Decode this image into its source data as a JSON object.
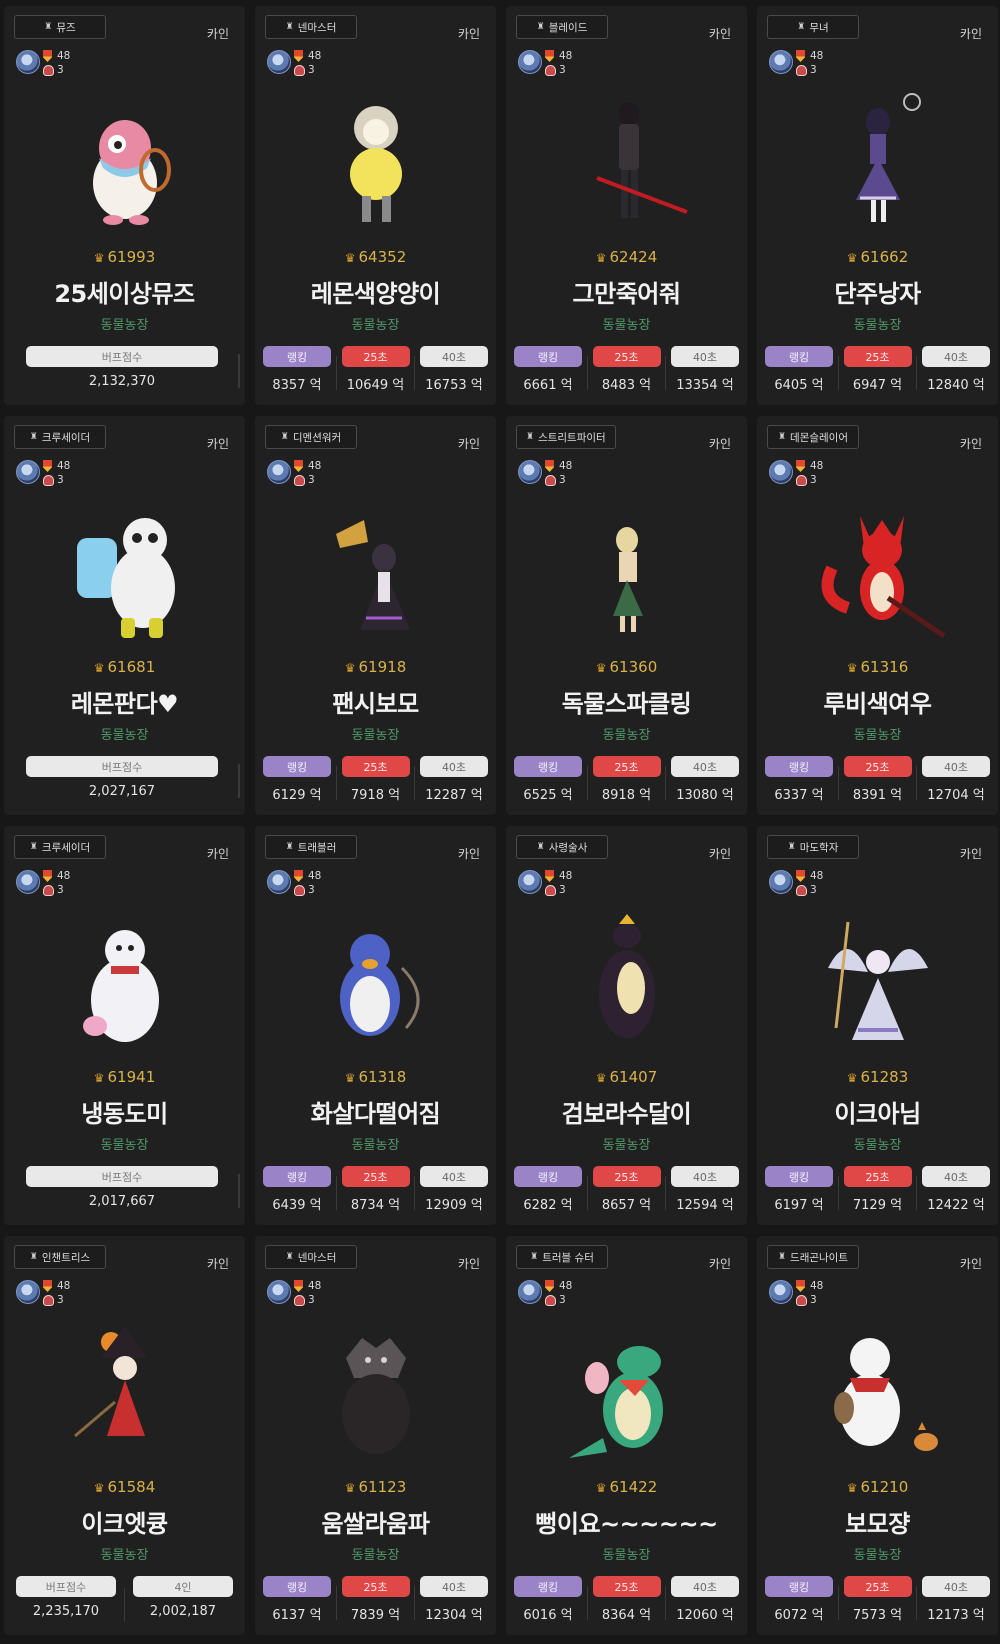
{
  "common": {
    "server": "카인",
    "level_top": "48",
    "level_bottom": "3",
    "unit": "억",
    "label_rank": "랭킹",
    "label_25": "25초",
    "label_40": "40초",
    "label_buff": "버프점수",
    "label_4p": "4인"
  },
  "cards": [
    {
      "job": "뮤즈",
      "fame": "61993",
      "name": "25세이상뮤즈",
      "guild": "동물농장",
      "type": "buff",
      "buff": "2,132,370",
      "sprite": "pink-penguin",
      "colors": [
        "#e88aa4",
        "#f5f0ea",
        "#c06a30"
      ]
    },
    {
      "job": "넨마스터",
      "fame": "64352",
      "name": "레몬색양양이",
      "guild": "동물농장",
      "type": "dps",
      "rank": "8357",
      "t25": "10649",
      "t40": "16753",
      "sprite": "yellow-sheep",
      "colors": [
        "#f2e25c",
        "#d9d2c0",
        "#8a8a8a"
      ]
    },
    {
      "job": "블레이드",
      "fame": "62424",
      "name": "그만죽어줘",
      "guild": "동물농장",
      "type": "dps",
      "rank": "6661",
      "t25": "8483",
      "t40": "13354",
      "sprite": "blade-girl",
      "colors": [
        "#3a3438",
        "#c21b22",
        "#e3d2c8"
      ]
    },
    {
      "job": "무녀",
      "fame": "61662",
      "name": "단주낭자",
      "guild": "동물농장",
      "type": "dps",
      "rank": "6405",
      "t25": "6947",
      "t40": "12840",
      "sprite": "dress-girl",
      "colors": [
        "#5b4a8e",
        "#d8d0ea",
        "#2a2440"
      ]
    },
    {
      "job": "크루세이더",
      "fame": "61681",
      "name": "레몬판다♥",
      "guild": "동물농장",
      "type": "buff",
      "buff": "2,027,167",
      "sprite": "panda",
      "colors": [
        "#f0f0f0",
        "#d8cf32",
        "#8ad0ee"
      ]
    },
    {
      "job": "디멘션워커",
      "fame": "61918",
      "name": "팬시보모",
      "guild": "동물농장",
      "type": "dps",
      "rank": "6129",
      "t25": "7918",
      "t40": "12287",
      "sprite": "witch",
      "colors": [
        "#2c2630",
        "#d3a240",
        "#a65acb"
      ]
    },
    {
      "job": "스트리트파이터",
      "fame": "61360",
      "name": "독물스파클링",
      "guild": "동물농장",
      "type": "dps",
      "rank": "6525",
      "t25": "8918",
      "t40": "13080",
      "sprite": "street-girl",
      "colors": [
        "#3b6a46",
        "#e8d6b4",
        "#1c1c1c"
      ]
    },
    {
      "job": "데몬슬레이어",
      "fame": "61316",
      "name": "루비색여우",
      "guild": "동물농장",
      "type": "dps",
      "rank": "6337",
      "t25": "8391",
      "t40": "12704",
      "sprite": "red-fox",
      "colors": [
        "#d82424",
        "#f3e0c8",
        "#5a1a1a"
      ]
    },
    {
      "job": "크루세이더",
      "fame": "61941",
      "name": "냉동도미",
      "guild": "동물농장",
      "type": "buff",
      "buff": "2,017,667",
      "sprite": "white-bear",
      "colors": [
        "#f2f2f6",
        "#c83a3a",
        "#f0a8c8"
      ]
    },
    {
      "job": "트래블러",
      "fame": "61318",
      "name": "화살다떨어짐",
      "guild": "동물농장",
      "type": "dps",
      "rank": "6439",
      "t25": "8734",
      "t40": "12909",
      "sprite": "blue-penguin",
      "colors": [
        "#4d62c4",
        "#f0f0f0",
        "#e6a22c"
      ]
    },
    {
      "job": "사령술사",
      "fame": "61407",
      "name": "검보라수달이",
      "guild": "동물농장",
      "type": "dps",
      "rank": "6282",
      "t25": "8657",
      "t40": "12594",
      "sprite": "otter",
      "colors": [
        "#2e2232",
        "#f0e2b0",
        "#e6b430"
      ]
    },
    {
      "job": "마도학자",
      "fame": "61283",
      "name": "이크아님",
      "guild": "동물농장",
      "type": "dps",
      "rank": "6197",
      "t25": "7129",
      "t40": "12422",
      "sprite": "angel",
      "colors": [
        "#d6d6ea",
        "#8a7ac4",
        "#d0a860"
      ]
    },
    {
      "job": "인챈트리스",
      "fame": "61584",
      "name": "이크엣큥",
      "guild": "동물농장",
      "type": "buff4",
      "buff": "2,235,170",
      "buff4": "2,002,187",
      "sprite": "pumpkin-witch",
      "colors": [
        "#c83030",
        "#2a2028",
        "#e88a2a"
      ]
    },
    {
      "job": "넨마스터",
      "fame": "61123",
      "name": "움쌀라움파",
      "guild": "동물농장",
      "type": "dps",
      "rank": "6137",
      "t25": "7839",
      "t40": "12304",
      "sprite": "black-wolf",
      "colors": [
        "#2a2628",
        "#5a5456",
        "#d6d6d6"
      ]
    },
    {
      "job": "트러블 슈터",
      "fame": "61422",
      "name": "뻥이요~~~~~~",
      "guild": "동물농장",
      "type": "dps",
      "rank": "6016",
      "t25": "8364",
      "t40": "12060",
      "sprite": "crocodile",
      "colors": [
        "#3aa87e",
        "#f0e6c0",
        "#e24a3a"
      ]
    },
    {
      "job": "드래곤나이트",
      "fame": "61210",
      "name": "보모쟝",
      "guild": "동물농장",
      "type": "dps",
      "rank": "6072",
      "t25": "7573",
      "t40": "12173",
      "sprite": "snowman",
      "colors": [
        "#f4f4f4",
        "#c83030",
        "#d88a3a"
      ]
    }
  ]
}
